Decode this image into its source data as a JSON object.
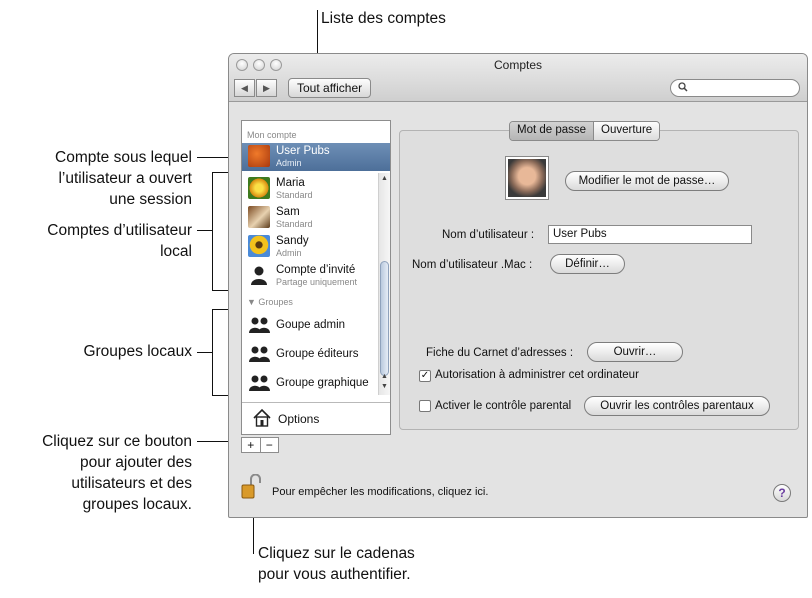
{
  "annotations": {
    "accounts_list": "Liste des comptes",
    "login_account": [
      "Compte sous lequel",
      "l’utilisateur a ouvert",
      "une session"
    ],
    "local_accounts": [
      "Comptes d’utilisateur",
      "local"
    ],
    "local_groups": "Groupes locaux",
    "add_button": [
      "Cliquez sur ce bouton",
      "pour ajouter des",
      "utilisateurs et des",
      "groupes locaux."
    ],
    "lock": [
      "Cliquez sur le cadenas",
      "pour vous authentifier."
    ]
  },
  "window": {
    "title": "Comptes",
    "show_all": "Tout afficher",
    "search_placeholder": ""
  },
  "sidebar": {
    "my_account_header": "Mon compte",
    "my_account": {
      "name": "User Pubs",
      "role": "Admin"
    },
    "accounts": [
      {
        "name": "Maria",
        "role": "Standard"
      },
      {
        "name": "Sam",
        "role": "Standard"
      },
      {
        "name": "Sandy",
        "role": "Admin"
      },
      {
        "name": "Compte d’invité",
        "role": "Partage uniquement"
      }
    ],
    "groups_header": "▼ Groupes",
    "groups": [
      "Goupe admin",
      "Groupe éditeurs",
      "Groupe graphique"
    ],
    "options": "Options",
    "add": "+",
    "remove": "−"
  },
  "panel": {
    "tabs": [
      "Mot de passe",
      "Ouverture"
    ],
    "change_password": "Modifier le mot de passe…",
    "username_label": "Nom d’utilisateur :",
    "username_value": "User Pubs",
    "mac_label": "Nom d’utilisateur .Mac :",
    "define": "Définir…",
    "address_book_label": "Fiche du Carnet d’adresses :",
    "open": "Ouvrir…",
    "admin_checkbox": "Autorisation à administrer cet ordinateur",
    "parental_checkbox": "Activer le contrôle parental",
    "parental_button": "Ouvrir les contrôles parentaux"
  },
  "footer": {
    "lock_text": "Pour empêcher les modifications, cliquez ici.",
    "help": "?"
  },
  "colors": {
    "selection": "#5a7aa4",
    "window_bg": "#e3e3e3",
    "help_glyph": "#6b3ea1"
  }
}
